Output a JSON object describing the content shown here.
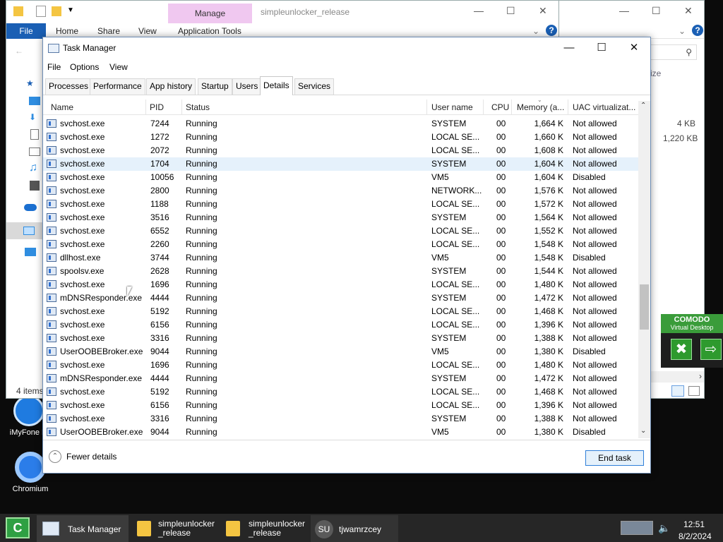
{
  "desktop": {
    "icons": [
      {
        "label": "iMyFone Fi"
      },
      {
        "label": "Chromium"
      }
    ]
  },
  "explorer_front": {
    "manage_label": "Manage",
    "title": "simpleunlocker_release",
    "tabs": [
      "File",
      "Home",
      "Share",
      "View",
      "Application Tools"
    ],
    "items_count": "4 items"
  },
  "explorer_back": {
    "col_size": "ize",
    "sizes": [
      "4 KB",
      "1,220 KB"
    ]
  },
  "taskmanager": {
    "title": "Task Manager",
    "menu": [
      "File",
      "Options",
      "View"
    ],
    "tabs": [
      "Processes",
      "Performance",
      "App history",
      "Startup",
      "Users",
      "Details",
      "Services"
    ],
    "active_tab": "Details",
    "columns": [
      "Name",
      "PID",
      "Status",
      "User name",
      "CPU",
      "Memory (a...",
      "UAC virtualizat..."
    ],
    "rows": [
      [
        "svchost.exe",
        "7244",
        "Running",
        "SYSTEM",
        "00",
        "1,664 K",
        "Not allowed"
      ],
      [
        "svchost.exe",
        "1272",
        "Running",
        "LOCAL SE...",
        "00",
        "1,660 K",
        "Not allowed"
      ],
      [
        "svchost.exe",
        "2072",
        "Running",
        "LOCAL SE...",
        "00",
        "1,608 K",
        "Not allowed"
      ],
      [
        "svchost.exe",
        "1704",
        "Running",
        "SYSTEM",
        "00",
        "1,604 K",
        "Not allowed"
      ],
      [
        "svchost.exe",
        "10056",
        "Running",
        "VM5",
        "00",
        "1,604 K",
        "Disabled"
      ],
      [
        "svchost.exe",
        "2800",
        "Running",
        "NETWORK...",
        "00",
        "1,576 K",
        "Not allowed"
      ],
      [
        "svchost.exe",
        "1188",
        "Running",
        "LOCAL SE...",
        "00",
        "1,572 K",
        "Not allowed"
      ],
      [
        "svchost.exe",
        "3516",
        "Running",
        "SYSTEM",
        "00",
        "1,564 K",
        "Not allowed"
      ],
      [
        "svchost.exe",
        "6552",
        "Running",
        "LOCAL SE...",
        "00",
        "1,552 K",
        "Not allowed"
      ],
      [
        "svchost.exe",
        "2260",
        "Running",
        "LOCAL SE...",
        "00",
        "1,548 K",
        "Not allowed"
      ],
      [
        "dllhost.exe",
        "3744",
        "Running",
        "VM5",
        "00",
        "1,548 K",
        "Disabled"
      ],
      [
        "spoolsv.exe",
        "2628",
        "Running",
        "SYSTEM",
        "00",
        "1,544 K",
        "Not allowed"
      ],
      [
        "svchost.exe",
        "1696",
        "Running",
        "LOCAL SE...",
        "00",
        "1,480 K",
        "Not allowed"
      ],
      [
        "mDNSResponder.exe",
        "4444",
        "Running",
        "SYSTEM",
        "00",
        "1,472 K",
        "Not allowed"
      ],
      [
        "svchost.exe",
        "5192",
        "Running",
        "LOCAL SE...",
        "00",
        "1,468 K",
        "Not allowed"
      ],
      [
        "svchost.exe",
        "6156",
        "Running",
        "LOCAL SE...",
        "00",
        "1,396 K",
        "Not allowed"
      ],
      [
        "svchost.exe",
        "3316",
        "Running",
        "SYSTEM",
        "00",
        "1,388 K",
        "Not allowed"
      ],
      [
        "UserOOBEBroker.exe",
        "9044",
        "Running",
        "VM5",
        "00",
        "1,380 K",
        "Disabled"
      ],
      [
        "svchost.exe",
        "1696",
        "Running",
        "LOCAL SE...",
        "00",
        "1,480 K",
        "Not allowed"
      ],
      [
        "mDNSResponder.exe",
        "4444",
        "Running",
        "SYSTEM",
        "00",
        "1,472 K",
        "Not allowed"
      ],
      [
        "svchost.exe",
        "5192",
        "Running",
        "LOCAL SE...",
        "00",
        "1,468 K",
        "Not allowed"
      ],
      [
        "svchost.exe",
        "6156",
        "Running",
        "LOCAL SE...",
        "00",
        "1,396 K",
        "Not allowed"
      ],
      [
        "svchost.exe",
        "3316",
        "Running",
        "SYSTEM",
        "00",
        "1,388 K",
        "Not allowed"
      ],
      [
        "UserOOBEBroker.exe",
        "9044",
        "Running",
        "VM5",
        "00",
        "1,380 K",
        "Disabled"
      ]
    ],
    "selected_row": 3,
    "fewer_details": "Fewer details",
    "end_task": "End task"
  },
  "comodo": {
    "brand": "COMODO",
    "subtitle": "Virtual Desktop"
  },
  "taskbar": {
    "items": [
      {
        "label": "Task Manager"
      },
      {
        "label": "simpleunlocker\n_release"
      },
      {
        "label": "simpleunlocker\n_release"
      },
      {
        "label": "tjwamrzcey"
      }
    ],
    "time": "12:51",
    "date": "8/2/2024"
  },
  "colors": {
    "accent": "#1a5fb4",
    "selection": "#e5f1fb",
    "comodo_green": "#3a9c3a",
    "manage_tab": "#f0c8f0"
  }
}
